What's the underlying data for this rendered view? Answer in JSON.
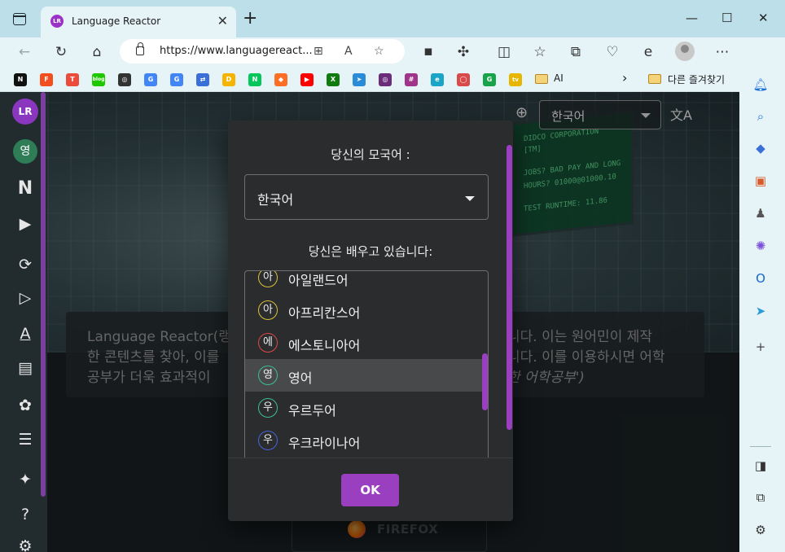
{
  "browser": {
    "tab_title": "Language Reactor",
    "tab_close": "✕",
    "new_tab": "+",
    "url": "https://www.languagereact...",
    "window_controls": {
      "minimize": "—",
      "maximize": "☐",
      "close": "✕"
    },
    "bookmarks": [
      {
        "icon": "notion-icon",
        "label": "N",
        "color": "#111111"
      },
      {
        "icon": "figma-icon",
        "label": "F",
        "color": "#f24e1e"
      },
      {
        "icon": "tistory-icon",
        "label": "T",
        "color": "#ea4b3a"
      },
      {
        "icon": "blog-icon",
        "label": "blog",
        "color": "#1ec800"
      },
      {
        "icon": "globe-icon",
        "label": "◎",
        "color": "#333333"
      },
      {
        "icon": "google-icon",
        "label": "G",
        "color": "#4285f4"
      },
      {
        "icon": "google-icon",
        "label": "G",
        "color": "#4285f4"
      },
      {
        "icon": "translate-icon",
        "label": "⇄",
        "color": "#3a6fd8"
      },
      {
        "icon": "drive-icon",
        "label": "D",
        "color": "#f4b400"
      },
      {
        "icon": "naver-icon",
        "label": "N",
        "color": "#03c75a"
      },
      {
        "icon": "gitlab-icon",
        "label": "◆",
        "color": "#fc6d26"
      },
      {
        "icon": "youtube-icon",
        "label": "▶",
        "color": "#ff0000"
      },
      {
        "icon": "xbox-icon",
        "label": "X",
        "color": "#107c10"
      },
      {
        "icon": "plane-icon",
        "label": "➤",
        "color": "#2a8bd8"
      },
      {
        "icon": "openai-icon",
        "label": "◎",
        "color": "#6b2d7a"
      },
      {
        "icon": "slack-icon",
        "label": "#",
        "color": "#a0338a"
      },
      {
        "icon": "edge-icon",
        "label": "e",
        "color": "#1aa4c8"
      },
      {
        "icon": "capsule-icon",
        "label": "◯",
        "color": "#d94b4b"
      },
      {
        "icon": "grammar-icon",
        "label": "G",
        "color": "#16a34a"
      },
      {
        "icon": "tv-icon",
        "label": "tv",
        "color": "#e7b600"
      }
    ],
    "bookmark_folder": "AI",
    "other_favorites": "다른 즐겨찾기",
    "chevron": "›"
  },
  "page": {
    "top_language": "한국어",
    "translate_icon": "文A",
    "hero_screen_lines": [
      "DIDCO CORPORATION",
      "[TM]",
      "JOBS? BAD PAY AND LONG",
      "HOURS? 01000@01000.10",
      "TEST RUNTIME: 11.86"
    ],
    "intro_lines": [
      "Language Reactor(랭",
      "한 콘텐츠를 찾아, 이를",
      "공부가 더욱 효과적이"
    ],
    "intro_lines_right": [
      "니다. 이는 원어민이 제작",
      "니다. 이를 이용하시면 어학",
      "한 어학공부')"
    ],
    "firefox_label": "FIREFOX",
    "rail_logo": "LR",
    "rail_lang": "영"
  },
  "modal": {
    "native_label": "당신의 모국어 :",
    "native_value": "한국어",
    "learning_label": "당신은 배우고 있습니다:",
    "languages": [
      {
        "badge": "아",
        "name": "아일랜드어",
        "color": "#d9c23a",
        "selected": false
      },
      {
        "badge": "아",
        "name": "아프리칸스어",
        "color": "#d9c23a",
        "selected": false
      },
      {
        "badge": "에",
        "name": "에스토니아어",
        "color": "#e04848",
        "selected": false
      },
      {
        "badge": "영",
        "name": "영어",
        "color": "#3fbf8f",
        "selected": true
      },
      {
        "badge": "우",
        "name": "우르두어",
        "color": "#3fbf8f",
        "selected": false
      },
      {
        "badge": "우",
        "name": "우크라이나어",
        "color": "#4a63d8",
        "selected": false
      }
    ],
    "ok_label": "OK"
  }
}
